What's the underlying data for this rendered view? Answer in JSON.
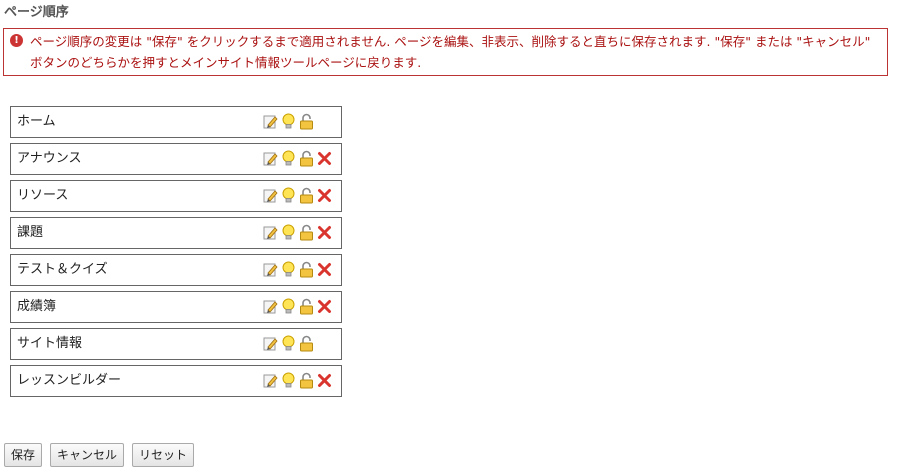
{
  "page_title": "ページ順序",
  "alert": {
    "icon": "error-icon",
    "text": "ページ順序の変更は \"保存\" をクリックするまで適用されません. ページを編集、非表示、削除すると直ちに保存されます. \"保存\" または \"キャンセル\" ボタンのどちらかを押すとメインサイト情報ツールページに戻ります."
  },
  "pages": [
    {
      "name": "ホーム",
      "deletable": false
    },
    {
      "name": "アナウンス",
      "deletable": true
    },
    {
      "name": "リソース",
      "deletable": true
    },
    {
      "name": "課題",
      "deletable": true
    },
    {
      "name": "テスト＆クイズ",
      "deletable": true
    },
    {
      "name": "成績簿",
      "deletable": true
    },
    {
      "name": "サイト情報",
      "deletable": false
    },
    {
      "name": "レッスンビルダー",
      "deletable": true
    }
  ],
  "icons": [
    "pencil-edit-icon",
    "lightbulb-visibility-icon",
    "unlock-icon",
    "delete-x-icon"
  ],
  "buttons": {
    "save": "保存",
    "cancel": "キャンセル",
    "reset": "リセット"
  },
  "colors": {
    "alert_border": "#bb3333",
    "alert_text": "#aa1111",
    "delete_red": "#d9352e"
  }
}
